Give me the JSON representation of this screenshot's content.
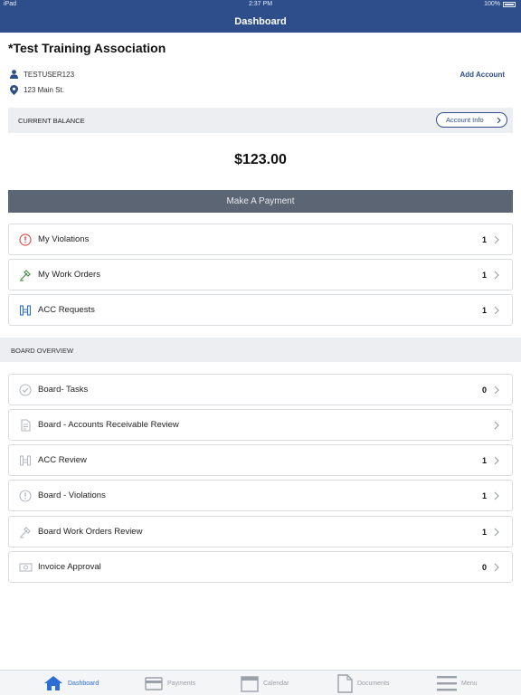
{
  "status_bar": {
    "carrier": "iPad",
    "time": "2:37 PM",
    "battery": "100%"
  },
  "nav": {
    "title": "Dashboard"
  },
  "org": {
    "title": "*Test Training Association",
    "username": "TESTUSER123",
    "address": "123 Main St.",
    "add_account": "Add Account"
  },
  "balance": {
    "label": "CURRENT BALANCE",
    "account_info": "Account Info",
    "amount": "$123.00",
    "pay_button": "Make A Payment"
  },
  "my_items": [
    {
      "label": "My Violations",
      "count": "1",
      "icon": "alert-circle-icon"
    },
    {
      "label": "My Work Orders",
      "count": "1",
      "icon": "wrench-icon"
    },
    {
      "label": "ACC Requests",
      "count": "1",
      "icon": "building-icon"
    }
  ],
  "board": {
    "header": "BOARD OVERVIEW",
    "items": [
      {
        "label": "Board- Tasks",
        "count": "0",
        "icon": "check-circle-icon"
      },
      {
        "label": "Board - Accounts Receivable Review",
        "count": "",
        "icon": "document-icon"
      },
      {
        "label": "ACC Review",
        "count": "1",
        "icon": "building-icon"
      },
      {
        "label": "Board - Violations",
        "count": "1",
        "icon": "alert-circle-icon"
      },
      {
        "label": "Board Work Orders Review",
        "count": "1",
        "icon": "wrench-icon"
      },
      {
        "label": "Invoice Approval",
        "count": "0",
        "icon": "money-icon"
      }
    ]
  },
  "tabs": [
    {
      "label": "Dashboard",
      "icon": "home-icon",
      "active": true
    },
    {
      "label": "Payments",
      "icon": "credit-card-icon",
      "active": false
    },
    {
      "label": "Calendar",
      "icon": "calendar-icon",
      "active": false
    },
    {
      "label": "Documents",
      "icon": "document-icon",
      "active": false
    },
    {
      "label": "Menu",
      "icon": "hamburger-icon",
      "active": false
    }
  ],
  "colors": {
    "brand": "#2d4e8a",
    "pay_button": "#5b6573",
    "alert": "#d9534f",
    "tab_active": "#2d6ed4"
  }
}
